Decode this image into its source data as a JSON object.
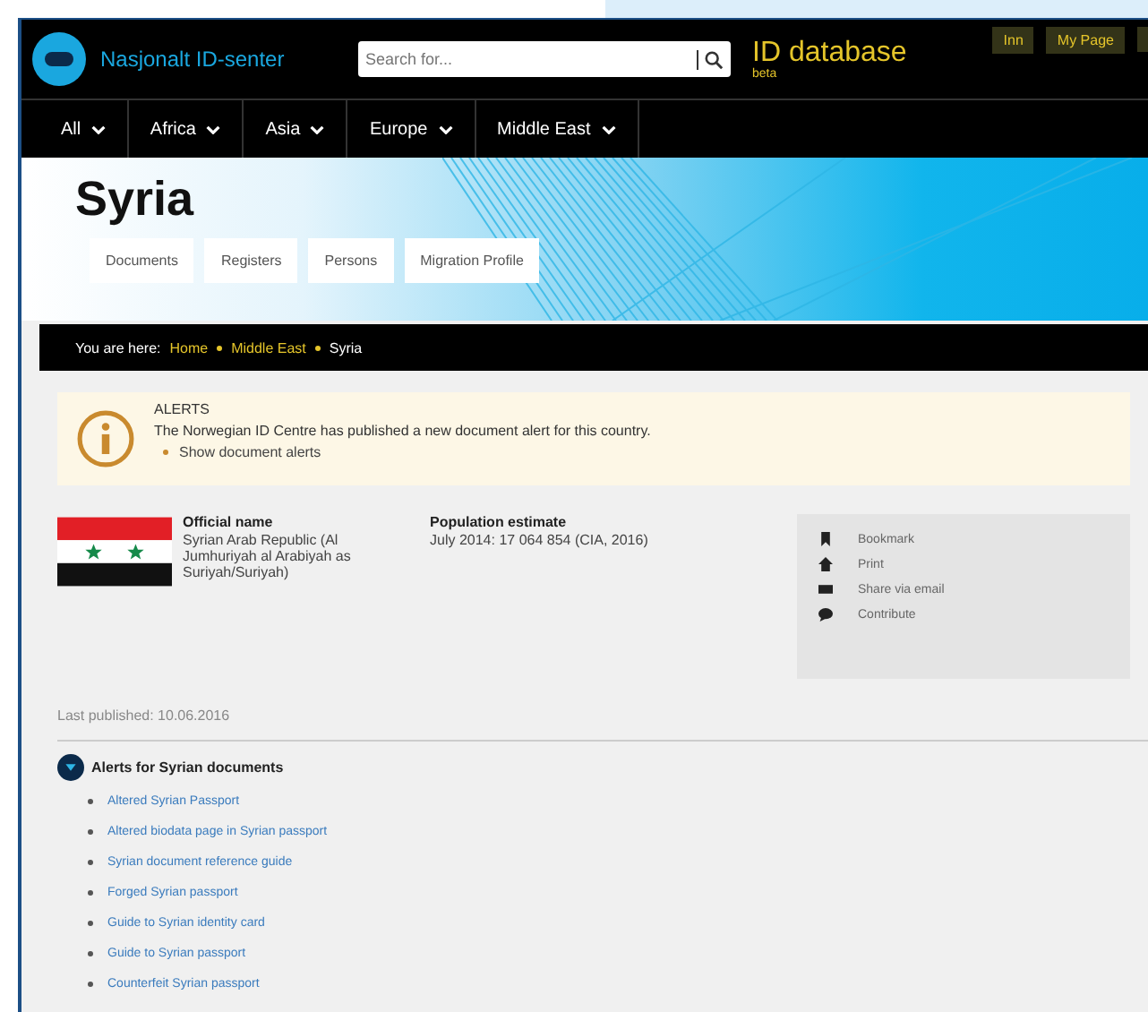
{
  "header": {
    "site_name": "Nasjonalt ID-senter",
    "search": {
      "placeholder": "Search for..."
    },
    "product": "ID database",
    "product_tag": "beta",
    "buttons": [
      "Inn",
      "My Page"
    ]
  },
  "nav": [
    {
      "label": "All"
    },
    {
      "label": "Africa"
    },
    {
      "label": "Asia"
    },
    {
      "label": "Europe"
    },
    {
      "label": "Middle East"
    }
  ],
  "hero": {
    "title": "Syria",
    "tabs": [
      "Documents",
      "Registers",
      "Persons",
      "Migration Profile"
    ]
  },
  "breadcrumb": {
    "prefix": "You are here:",
    "links": [
      "Home",
      "Middle East"
    ],
    "current": "Syria"
  },
  "alert": {
    "title": "ALERTS",
    "message": "The Norwegian ID Centre has published a new document alert for this country.",
    "link": "Show document alerts"
  },
  "country": {
    "official_name_label": "Official name",
    "official_name": "Syrian Arab Republic (Al Jumhuriyah al Arabiyah as Suriyah/Suriyah)",
    "population_label": "Population estimate",
    "population": "July 2014: 17 064 854 (CIA, 2016)"
  },
  "actions": [
    {
      "kind": "bookmark",
      "label": "Bookmark"
    },
    {
      "kind": "print",
      "label": "Print"
    },
    {
      "kind": "email",
      "label": "Share via email"
    },
    {
      "kind": "contribute",
      "label": "Contribute"
    }
  ],
  "last_published": "Last published: 10.06.2016",
  "alerts_section": {
    "title": "Alerts for Syrian documents",
    "items": [
      "Altered Syrian Passport",
      "Altered biodata page in Syrian passport",
      "Syrian document reference guide",
      "Forged Syrian passport",
      "Guide to Syrian identity card",
      "Guide to Syrian passport",
      "Counterfeit Syrian passport"
    ]
  }
}
